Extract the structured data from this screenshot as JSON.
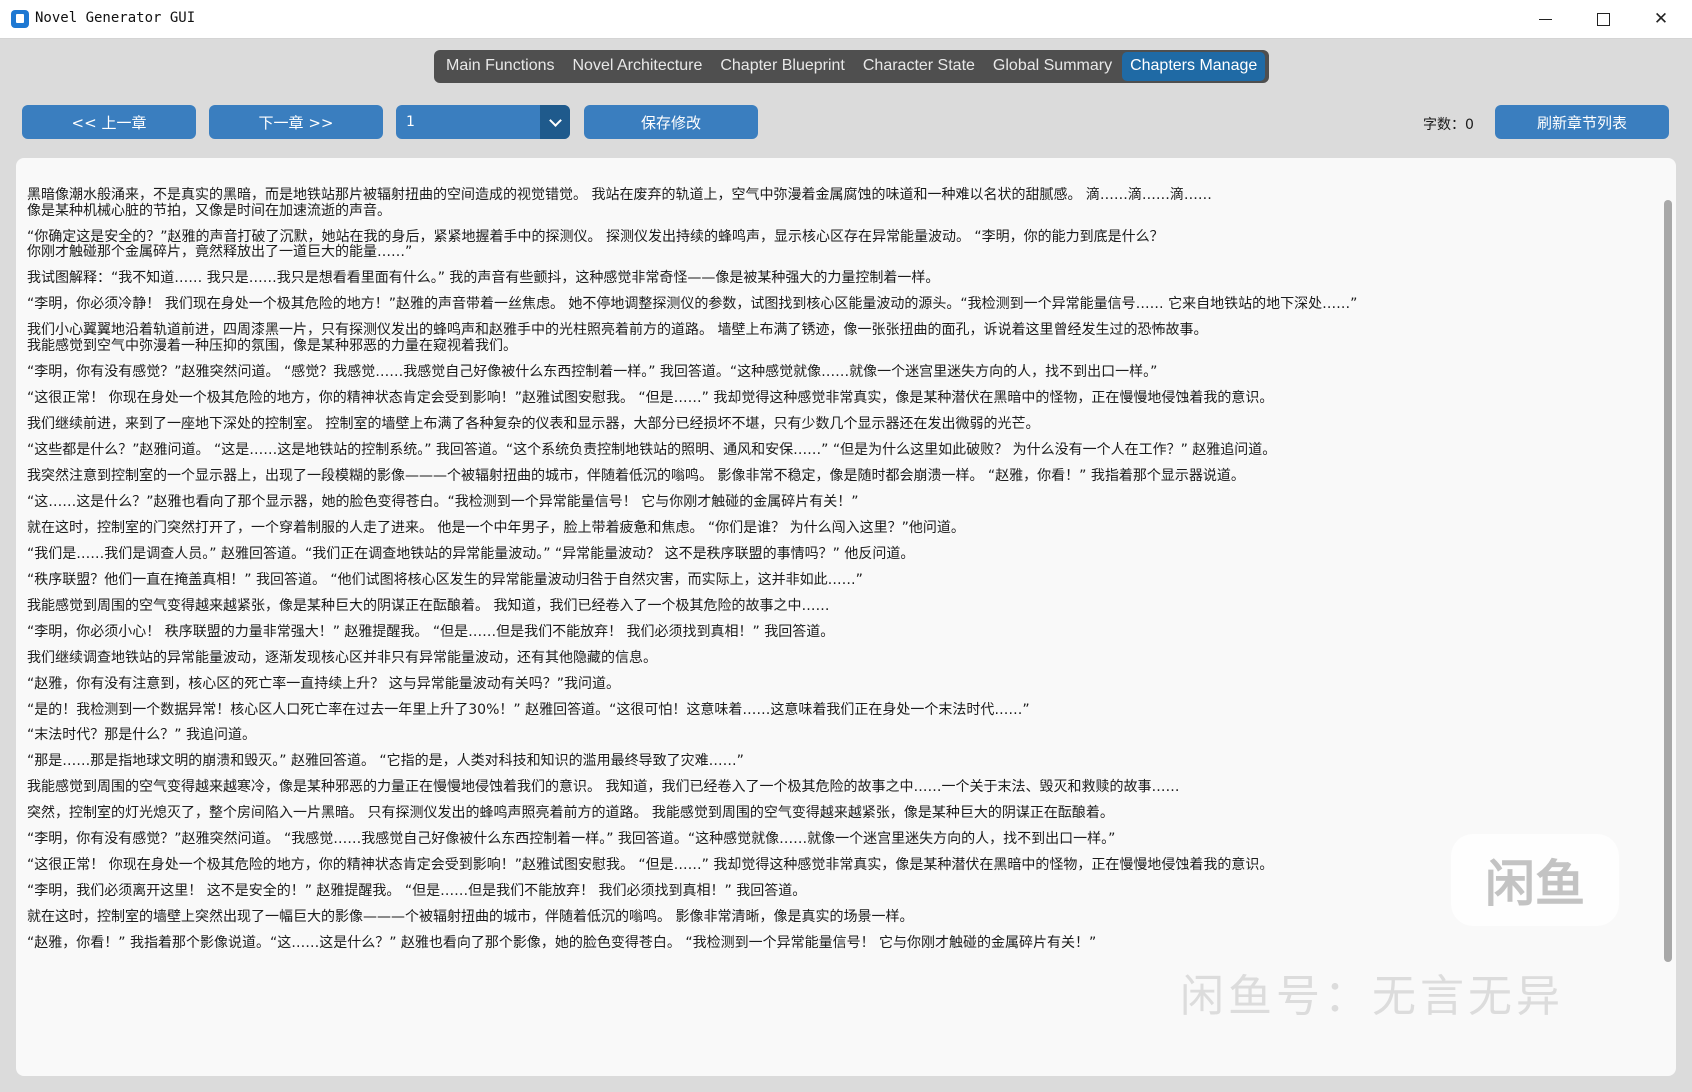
{
  "window": {
    "title": "Novel Generator GUI",
    "minimize_icon": "minimize-icon",
    "maximize_icon": "maximize-icon",
    "close_symbol": "✕"
  },
  "tabs": [
    {
      "label": "Main Functions"
    },
    {
      "label": "Novel Architecture"
    },
    {
      "label": "Chapter Blueprint"
    },
    {
      "label": "Character State"
    },
    {
      "label": "Global Summary"
    },
    {
      "label": "Chapters Manage",
      "active": true
    }
  ],
  "toolbar": {
    "prev_label": "<< 上一章",
    "next_label": "下一章 >>",
    "chapter_value": "1",
    "save_label": "保存修改",
    "word_count": "字数：0",
    "refresh_label": "刷新章节列表"
  },
  "colors": {
    "accent": "#3a7ebf",
    "active_tab": "#1f6aa5",
    "tab_bar": "#4f4f4f"
  },
  "content": {
    "paragraphs": [
      "黑暗像潮水般涌来，不是真实的黑暗，而是地铁站那片被辐射扭曲的空间造成的视觉错觉。 我站在废弃的轨道上，空气中弥漫着金属腐蚀的味道和一种难以名状的甜腻感。 滴……滴……滴……\n像是某种机械心脏的节拍，又像是时间在加速流逝的声音。",
      "“你确定这是安全的？”赵雅的声音打破了沉默，她站在我的身后，紧紧地握着手中的探测仪。 探测仪发出持续的蜂鸣声，显示核心区存在异常能量波动。 “李明，你的能力到底是什么？\n你刚才触碰那个金属碎片，竟然释放出了一道巨大的能量……”",
      "我试图解释：“我不知道…… 我只是……我只是想看看里面有什么。” 我的声音有些颤抖，这种感觉非常奇怪——像是被某种强大的力量控制着一样。",
      "“李明，你必须冷静！ 我们现在身处一个极其危险的地方！”赵雅的声音带着一丝焦虑。 她不停地调整探测仪的参数，试图找到核心区能量波动的源头。“我检测到一个异常能量信号…… 它来自地铁站的地下深处……”",
      "我们小心翼翼地沿着轨道前进，四周漆黑一片，只有探测仪发出的蜂鸣声和赵雅手中的光柱照亮着前方的道路。 墙壁上布满了锈迹，像一张张扭曲的面孔，诉说着这里曾经发生过的恐怖故事。\n我能感觉到空气中弥漫着一种压抑的氛围，像是某种邪恶的力量在窥视着我们。",
      "“李明，你有没有感觉？”赵雅突然问道。 “感觉？我感觉……我感觉自己好像被什么东西控制着一样。” 我回答道。“这种感觉就像……就像一个迷宫里迷失方向的人，找不到出口一样。”",
      "“这很正常！ 你现在身处一个极其危险的地方，你的精神状态肯定会受到影响！”赵雅试图安慰我。 “但是……” 我却觉得这种感觉非常真实，像是某种潜伏在黑暗中的怪物，正在慢慢地侵蚀着我的意识。",
      "我们继续前进，来到了一座地下深处的控制室。 控制室的墙壁上布满了各种复杂的仪表和显示器，大部分已经损坏不堪，只有少数几个显示器还在发出微弱的光芒。",
      "“这些都是什么？”赵雅问道。 “这是……这是地铁站的控制系统。” 我回答道。“这个系统负责控制地铁站的照明、通风和安保……” “但是为什么这里如此破败？ 为什么没有一个人在工作？” 赵雅追问道。",
      "我突然注意到控制室的一个显示器上，出现了一段模糊的影像———个被辐射扭曲的城市，伴随着低沉的嗡鸣。 影像非常不稳定，像是随时都会崩溃一样。 “赵雅，你看！” 我指着那个显示器说道。",
      "“这……这是什么？”赵雅也看向了那个显示器，她的脸色变得苍白。“我检测到一个异常能量信号！ 它与你刚才触碰的金属碎片有关！”",
      "就在这时，控制室的门突然打开了，一个穿着制服的人走了进来。 他是一个中年男子，脸上带着疲惫和焦虑。 “你们是谁？ 为什么闯入这里？”他问道。",
      "“我们是……我们是调查人员。” 赵雅回答道。“我们正在调查地铁站的异常能量波动。” “异常能量波动？ 这不是秩序联盟的事情吗？” 他反问道。",
      "“秩序联盟？他们一直在掩盖真相！” 我回答道。 “他们试图将核心区发生的异常能量波动归咎于自然灾害，而实际上，这并非如此……”",
      "我能感觉到周围的空气变得越来越紧张，像是某种巨大的阴谋正在酝酿着。 我知道，我们已经卷入了一个极其危险的故事之中……",
      "“李明，你必须小心！ 秩序联盟的力量非常强大！” 赵雅提醒我。 “但是……但是我们不能放弃！ 我们必须找到真相！” 我回答道。",
      "我们继续调查地铁站的异常能量波动，逐渐发现核心区并非只有异常能量波动，还有其他隐藏的信息。",
      "“赵雅，你有没有注意到，核心区的死亡率一直持续上升？ 这与异常能量波动有关吗？”我问道。",
      "“是的！我检测到一个数据异常！核心区人口死亡率在过去一年里上升了30%！” 赵雅回答道。“这很可怕！这意味着……这意味着我们正在身处一个末法时代……”",
      "“末法时代？那是什么？” 我追问道。",
      "“那是……那是指地球文明的崩溃和毁灭。” 赵雅回答道。 “它指的是，人类对科技和知识的滥用最终导致了灾难……”",
      "我能感觉到周围的空气变得越来越寒冷，像是某种邪恶的力量正在慢慢地侵蚀着我们的意识。 我知道，我们已经卷入了一个极其危险的故事之中……一个关于末法、毁灭和救赎的故事……",
      "突然，控制室的灯光熄灭了，整个房间陷入一片黑暗。 只有探测仪发出的蜂鸣声照亮着前方的道路。 我能感觉到周围的空气变得越来越紧张，像是某种巨大的阴谋正在酝酿着。",
      "“李明，你有没有感觉？”赵雅突然问道。 “我感觉……我感觉自己好像被什么东西控制着一样。” 我回答道。“这种感觉就像……就像一个迷宫里迷失方向的人，找不到出口一样。”",
      "“这很正常！ 你现在身处一个极其危险的地方，你的精神状态肯定会受到影响！”赵雅试图安慰我。 “但是……” 我却觉得这种感觉非常真实，像是某种潜伏在黑暗中的怪物，正在慢慢地侵蚀着我的意识。",
      "“李明，我们必须离开这里！ 这不是安全的！” 赵雅提醒我。 “但是……但是我们不能放弃！ 我们必须找到真相！” 我回答道。",
      "就在这时，控制室的墙壁上突然出现了一幅巨大的影像———个被辐射扭曲的城市，伴随着低沉的嗡鸣。 影像非常清晰，像是真实的场景一样。",
      "“赵雅，你看！” 我指着那个影像说道。“这……这是什么？” 赵雅也看向了那个影像，她的脸色变得苍白。 “我检测到一个异常能量信号！ 它与你刚才触碰的金属碎片有关！”"
    ]
  },
  "watermark": {
    "logo_text": "闲鱼",
    "text": "闲鱼号：无言无异"
  }
}
